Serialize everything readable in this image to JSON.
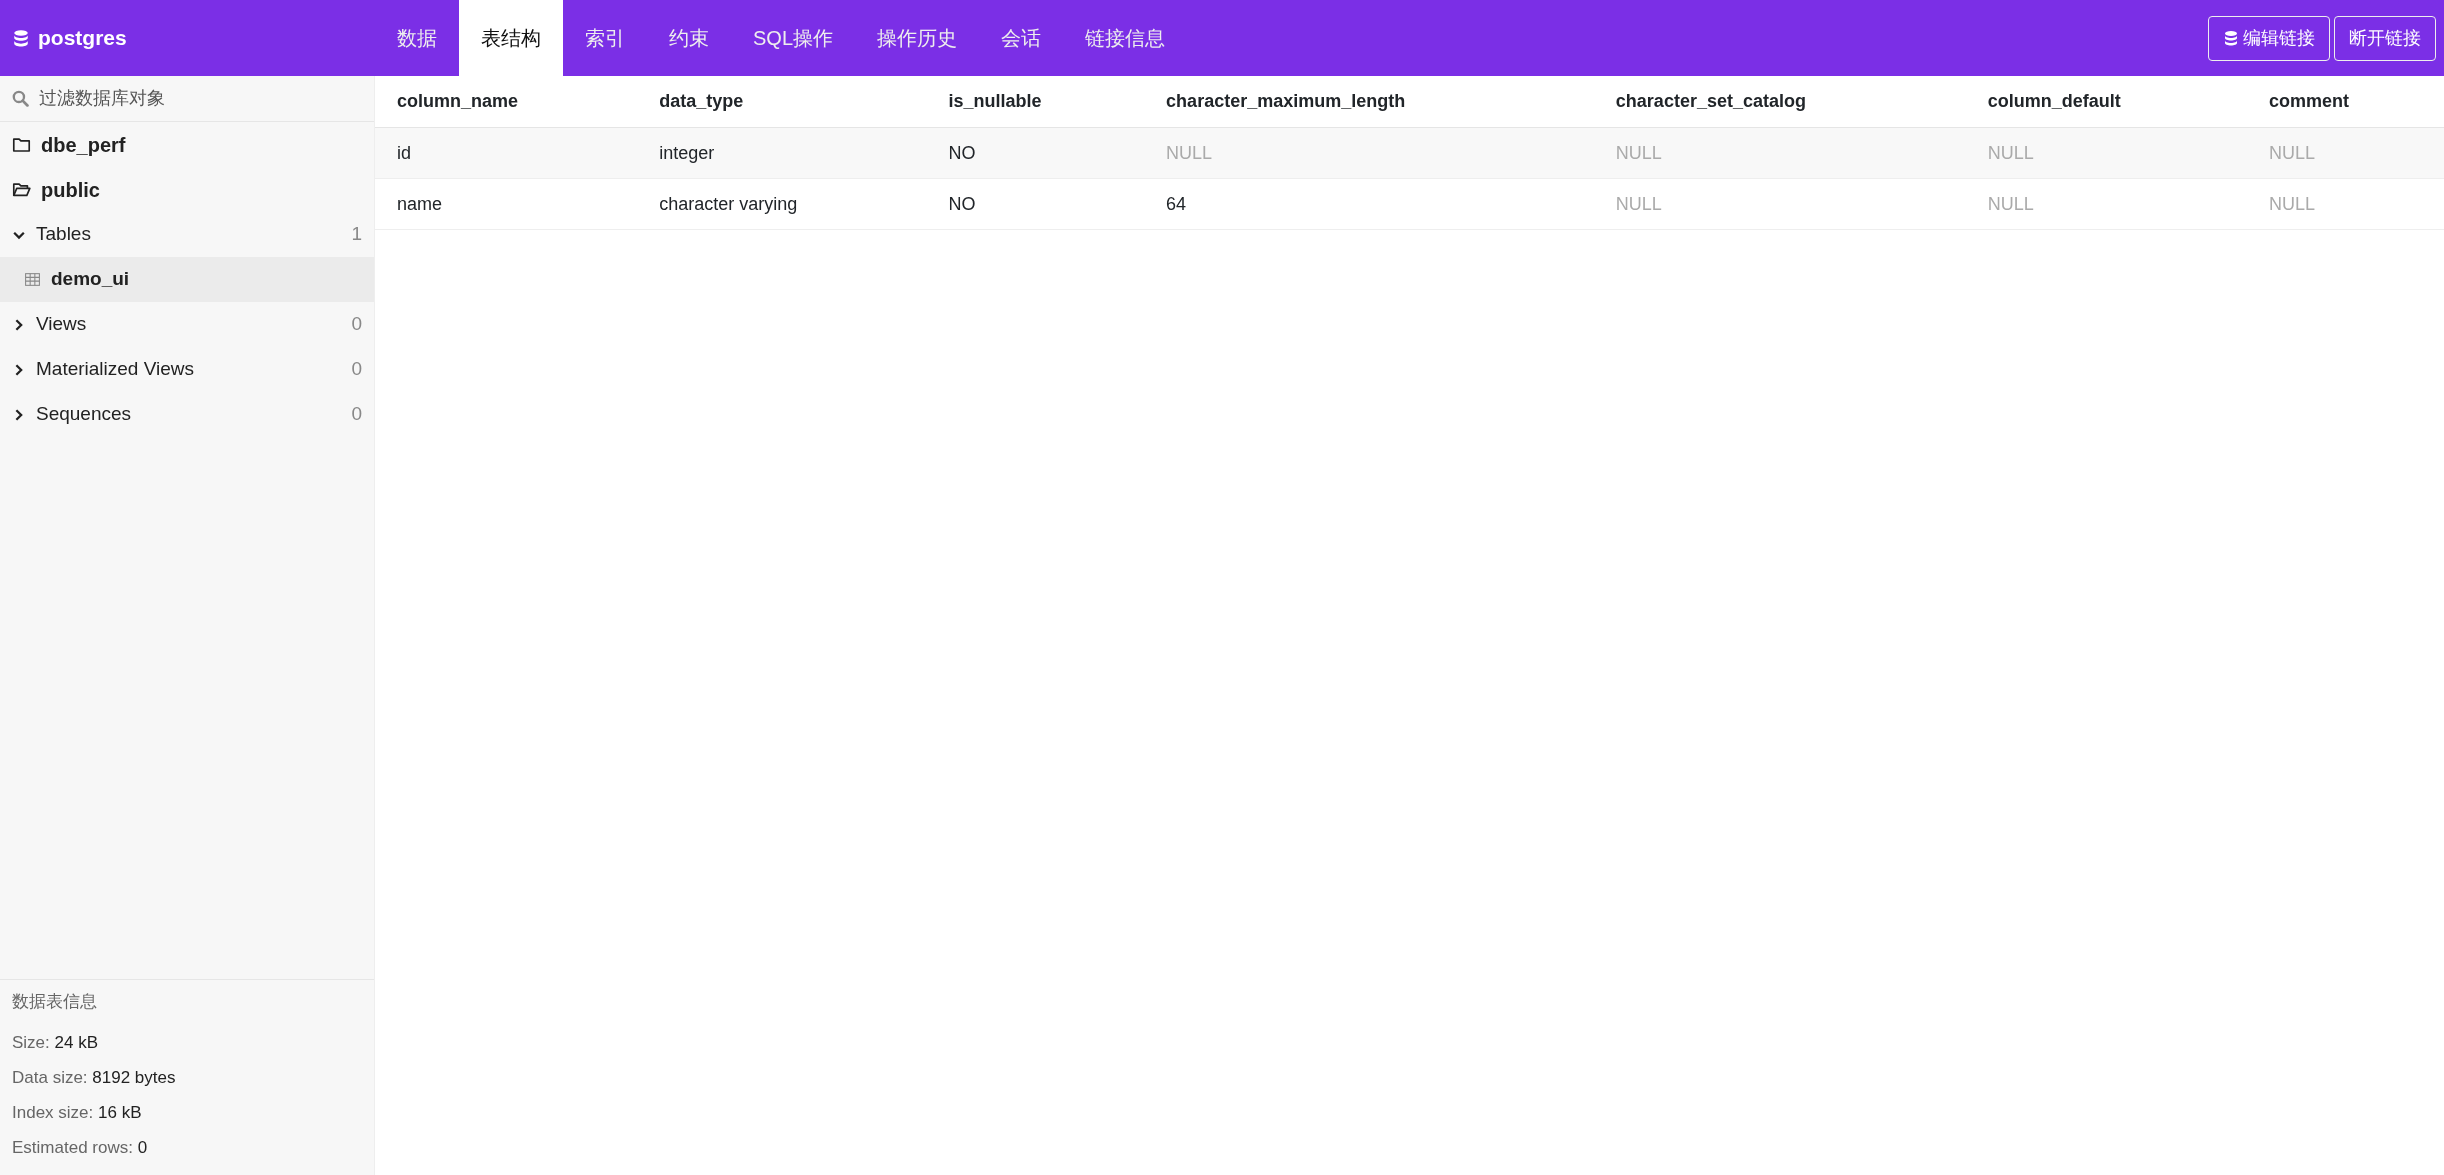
{
  "app": {
    "title": "postgres"
  },
  "tabs": [
    {
      "label": "数据",
      "selected": false
    },
    {
      "label": "表结构",
      "selected": true
    },
    {
      "label": "索引",
      "selected": false
    },
    {
      "label": "约束",
      "selected": false
    },
    {
      "label": "SQL操作",
      "selected": false
    },
    {
      "label": "操作历史",
      "selected": false
    },
    {
      "label": "会话",
      "selected": false
    },
    {
      "label": "链接信息",
      "selected": false
    }
  ],
  "actions": [
    {
      "label": "编辑链接",
      "icon": true
    },
    {
      "label": "断开链接",
      "icon": false
    }
  ],
  "sidebar": {
    "search": {
      "placeholder": "过滤数据库对象"
    },
    "schemas": [
      {
        "name": "dbe_perf",
        "expanded": false
      },
      {
        "name": "public",
        "expanded": true,
        "children": [
          {
            "name": "Tables",
            "count": "1",
            "expanded": true,
            "children": [
              {
                "name": "demo_ui",
                "selected": true
              }
            ]
          },
          {
            "name": "Views",
            "count": "0",
            "expanded": false
          },
          {
            "name": "Materialized Views",
            "count": "0",
            "expanded": false
          },
          {
            "name": "Sequences",
            "count": "0",
            "expanded": false
          }
        ]
      }
    ],
    "info": {
      "title": "数据表信息",
      "lines": [
        {
          "label": "Size:",
          "value": "24 kB"
        },
        {
          "label": "Data size:",
          "value": "8192 bytes"
        },
        {
          "label": "Index size:",
          "value": "16 kB"
        },
        {
          "label": "Estimated rows:",
          "value": "0"
        }
      ]
    }
  },
  "table": {
    "columns": [
      "column_name",
      "data_type",
      "is_nullable",
      "character_maximum_length",
      "character_set_catalog",
      "column_default",
      "comment"
    ],
    "rows": [
      [
        {
          "text": "id",
          "null": false
        },
        {
          "text": "integer",
          "null": false
        },
        {
          "text": "NO",
          "null": false
        },
        {
          "text": "NULL",
          "null": true
        },
        {
          "text": "NULL",
          "null": true
        },
        {
          "text": "NULL",
          "null": true
        },
        {
          "text": "NULL",
          "null": true
        }
      ],
      [
        {
          "text": "name",
          "null": false
        },
        {
          "text": "character varying",
          "null": false
        },
        {
          "text": "NO",
          "null": false
        },
        {
          "text": "64",
          "null": false
        },
        {
          "text": "NULL",
          "null": true
        },
        {
          "text": "NULL",
          "null": true
        },
        {
          "text": "NULL",
          "null": true
        }
      ]
    ]
  }
}
